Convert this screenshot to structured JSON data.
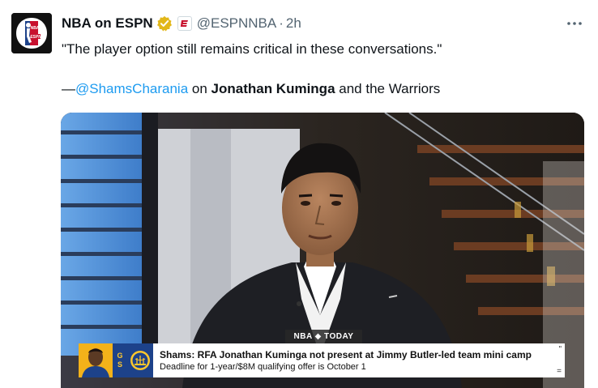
{
  "author": {
    "display_name": "NBA on ESPN",
    "handle": "@ESPNNBA",
    "separator": "·",
    "time": "2h",
    "avatar_text": "NBA ESPN",
    "verified_icon": "verified-badge-icon",
    "affiliate_icon": "espn-affiliate-icon"
  },
  "tweet": {
    "quote": "\"The player option still remains critical in these conversations.\"",
    "attribution_prefix": "—",
    "mention": "@ShamsCharania",
    "attribution_mid": " on ",
    "subject": "Jonathan Kuminga",
    "attribution_suffix": " and the Warriors"
  },
  "media": {
    "bug_label": "NBA ◆ TODAY",
    "ticker": {
      "team_abbr_top": "G",
      "team_abbr_bottom": "S",
      "headline": "Shams: RFA Jonathan Kuminga not present at Jimmy Butler-led team mini camp",
      "subline": "Deadline for 1-year/$8M qualifying offer is October 1",
      "edge_top": "\"",
      "edge_bottom": "="
    }
  },
  "colors": {
    "accent_link": "#1d9bf0",
    "secondary_text": "#536471",
    "verified_gold": "#e2b719",
    "warriors_blue": "#1d428a",
    "warriors_gold": "#ffc72c"
  }
}
